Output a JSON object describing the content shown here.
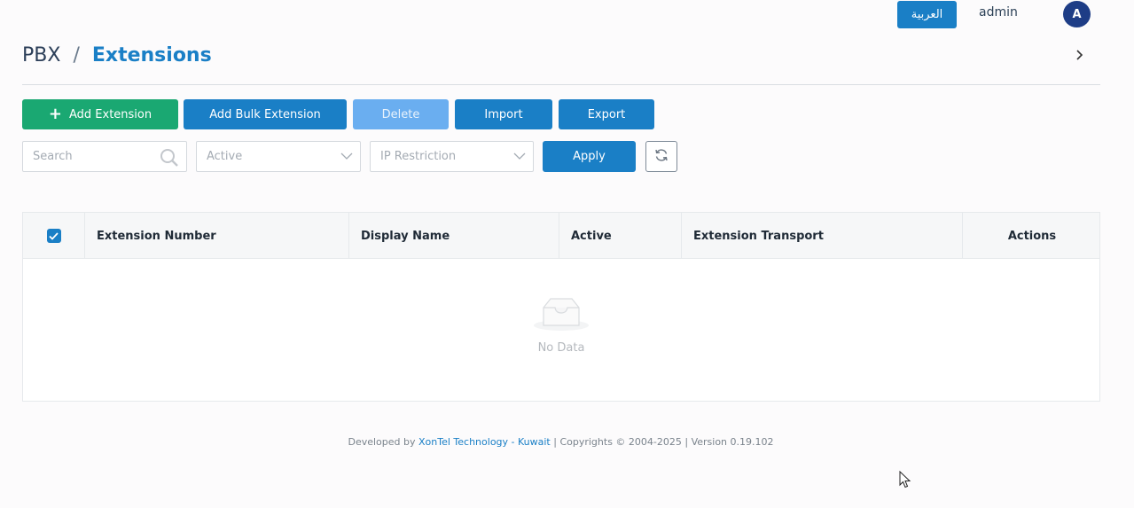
{
  "topbar": {
    "language_button": "العربية",
    "user_name": "admin",
    "avatar_initial": "A"
  },
  "breadcrumb": {
    "root": "PBX",
    "separator": "/",
    "current": "Extensions"
  },
  "toolbar": {
    "add_extension": "Add Extension",
    "add_bulk_extension": "Add Bulk Extension",
    "delete": "Delete",
    "import": "Import",
    "export": "Export"
  },
  "filters": {
    "search_placeholder": "Search",
    "active_placeholder": "Active",
    "ip_restriction_placeholder": "IP Restriction",
    "apply": "Apply"
  },
  "table": {
    "select_all_checked": true,
    "columns": [
      "Extension Number",
      "Display Name",
      "Active",
      "Extension Transport",
      "Actions"
    ],
    "rows": [],
    "empty_text": "No Data"
  },
  "footer": {
    "prefix": "Developed by",
    "company": "XonTel Technology - Kuwait",
    "suffix": "| Copyrights © 2004-2025 | Version 0.19.102"
  },
  "colors": {
    "primary": "#1a7fc6",
    "success": "#1aa872",
    "disabled": "#6aaef0",
    "avatar": "#1e3d86"
  }
}
